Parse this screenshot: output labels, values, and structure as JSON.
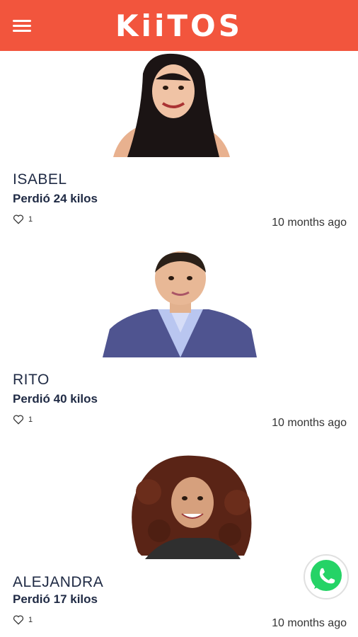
{
  "header": {
    "logo_text": "KiiTOS",
    "menu_icon": "hamburger-menu-icon",
    "background_color": "#f2553d"
  },
  "posts": [
    {
      "name": "ISABEL",
      "lost": "Perdió 24 kilos",
      "likes": "1",
      "time": "10 months ago"
    },
    {
      "name": "RITO",
      "lost": "Perdió 40 kilos",
      "likes": "1",
      "time": "10 months ago"
    },
    {
      "name": "ALEJANDRA",
      "lost": "Perdió 17 kilos",
      "likes": "1",
      "time": "10 months ago"
    }
  ],
  "floating": {
    "whatsapp_icon": "whatsapp-icon",
    "whatsapp_color": "#25d366"
  }
}
